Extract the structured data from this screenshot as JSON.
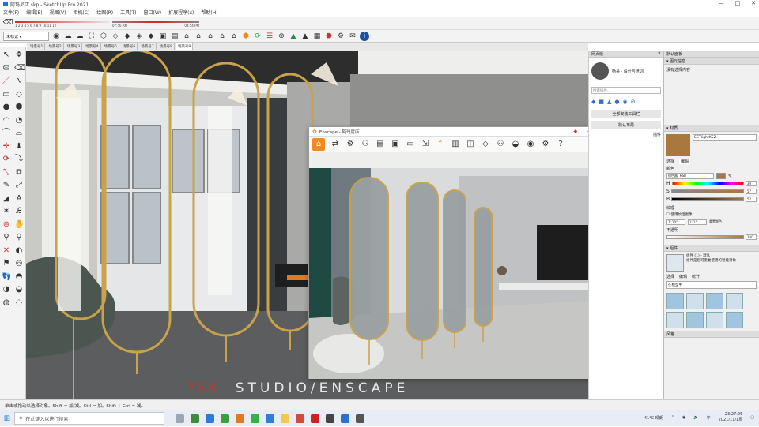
{
  "window": {
    "title": "阿玛尼店.skp - SketchUp Pro 2021",
    "controls": [
      "—",
      "□",
      "✕"
    ]
  },
  "menu": [
    "文件(F)",
    "编辑(E)",
    "视图(V)",
    "相机(C)",
    "绘图(R)",
    "工具(T)",
    "窗口(W)",
    "扩展程序(x)",
    "帮助(H)"
  ],
  "toolbar": {
    "layer_select": "未标记",
    "shadow_time_left": "07:56 AM",
    "shadow_time_right": "04:54 PM",
    "shadow_month_label": "1 2 3 4 5 6 7 8 9 10 11 12"
  },
  "scene_tabs": [
    "场景号1",
    "场景号2",
    "场景号3",
    "场景号4",
    "场景号5",
    "场景号6",
    "场景号7",
    "场景号8",
    "场景号9"
  ],
  "tray_panel": {
    "title": "默认面板",
    "entity_section": "图元信息",
    "entity_text": "没有选择内容",
    "materials_section": "材质",
    "material_name": "ECTlightKS2",
    "tabs": [
      "选择",
      "编辑"
    ],
    "color_label": "颜色",
    "picker_mode": "拾色器: HSB",
    "h_label": "H",
    "s_label": "S",
    "b_label": "B",
    "h_value": "30",
    "s_value": "57",
    "b_value": "57",
    "texture_label": "纹理",
    "use_texture_label": "使用纹理图像",
    "texture_w": "7' 10\"",
    "texture_h": "1' 1\"",
    "reset_color_label": "重置颜色",
    "opacity_label": "不透明",
    "opacity_value": "100",
    "components_section": "组件",
    "component_name": "组件 (1) - 默认",
    "component_desc": "组件是您可重复使用的智能对象",
    "component_tabs": [
      "选择",
      "编辑",
      "统计"
    ],
    "component_filter": "在模型中",
    "footer": "风格"
  },
  "chat_panel": {
    "title": "网页版",
    "user_name": "杨哥 · 设计与培训",
    "search_placeholder": "搜索插件...",
    "btn_primary": "全部安装工具栏",
    "btn_secondary": "默认布局",
    "label": "插件"
  },
  "enscape": {
    "title": "Enscape - 阿玛尼店"
  },
  "watermark": {
    "brand": "Y&K",
    "text": "STUDIO/ENSCAPE"
  },
  "status": {
    "text": "单击或拖动以选择对象。Shift = 加/减。Ctrl = 加。Shift + Ctrl = 减。"
  },
  "taskbar": {
    "search_placeholder": "在此键入以进行搜索",
    "weather": "41°C 晴朗",
    "time": "23:27:25",
    "date": "2021/11/1周"
  },
  "colors": {
    "accent": "#f28a1c",
    "gold": "#c9a24a",
    "material": "#a8783e"
  }
}
